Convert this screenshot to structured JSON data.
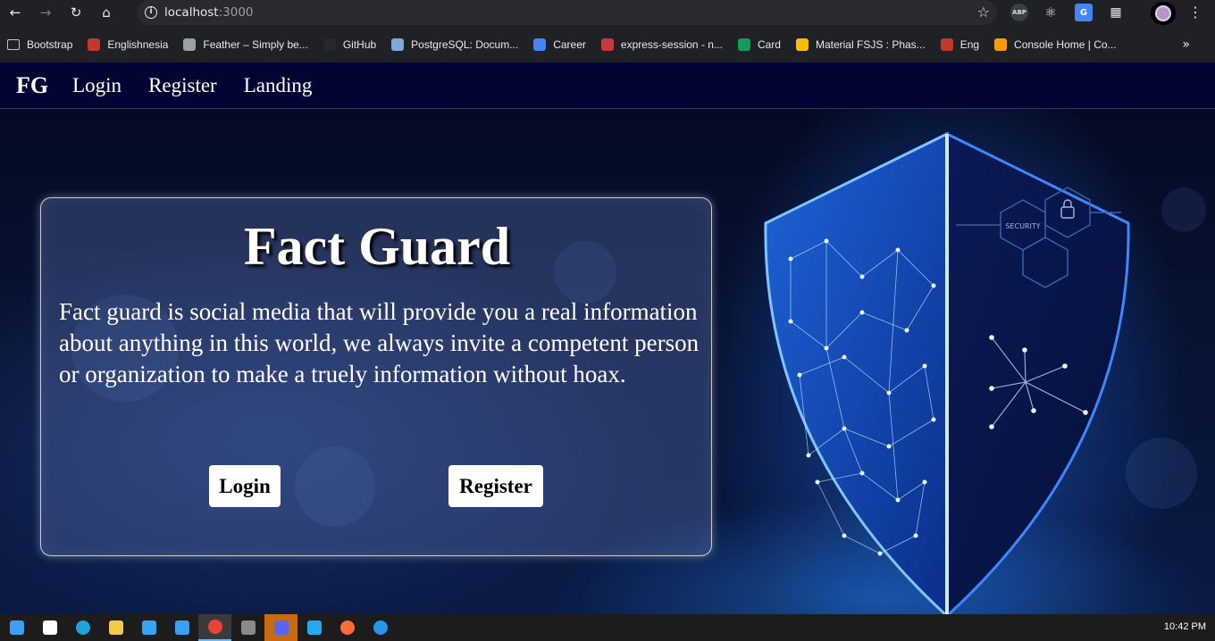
{
  "browser": {
    "url_host": "localhost",
    "url_port": ":3000",
    "extensions": {
      "abp_label": "ABP"
    }
  },
  "bookmarks": [
    {
      "label": "Bootstrap",
      "icon": "folder-icon",
      "color": "#c7c7c7"
    },
    {
      "label": "Englishnesia",
      "icon": "englishnesia-icon",
      "color": "#c0392b"
    },
    {
      "label": "Feather – Simply be...",
      "icon": "feather-icon",
      "color": "#9aa0a6"
    },
    {
      "label": "GitHub",
      "icon": "github-icon",
      "color": "#24292e"
    },
    {
      "label": "PostgreSQL: Docum...",
      "icon": "postgresql-icon",
      "color": "#7fa9d6"
    },
    {
      "label": "Career",
      "icon": "docs-icon",
      "color": "#4285f4"
    },
    {
      "label": "express-session - n...",
      "icon": "npm-icon",
      "color": "#cb3837"
    },
    {
      "label": "Card",
      "icon": "sheets-icon",
      "color": "#0f9d58"
    },
    {
      "label": "Material FSJS : Phas...",
      "icon": "drive-icon",
      "color": "#fbbc04"
    },
    {
      "label": "Eng",
      "icon": "eng-icon",
      "color": "#c0392b"
    },
    {
      "label": "Console Home | Co...",
      "icon": "aws-icon",
      "color": "#ff9900"
    }
  ],
  "app_nav": {
    "brand": "FG",
    "links": [
      "Login",
      "Register",
      "Landing"
    ]
  },
  "hero": {
    "title": "Fact Guard",
    "description": "Fact guard is social media that will provide you a real information about anything in this world, we always invite a competent person or organization to make a truely information without hoax.",
    "login_button": "Login",
    "register_button": "Register"
  },
  "shield": {
    "label": "SECURITY"
  },
  "taskbar": {
    "clock": "10:42 PM",
    "apps": [
      {
        "icon": "start-icon",
        "color": "#3aa0f3"
      },
      {
        "icon": "task-view-icon",
        "color": "#ffffff"
      },
      {
        "icon": "edge-icon",
        "color": "#1fa3d8"
      },
      {
        "icon": "file-explorer-icon",
        "color": "#f2c94c"
      },
      {
        "icon": "store-icon",
        "color": "#3aa0f3"
      },
      {
        "icon": "mail-icon",
        "color": "#3aa0f3"
      },
      {
        "icon": "chrome-icon",
        "color": "#ea4335"
      },
      {
        "icon": "calculator-icon",
        "color": "#8a8a8a"
      },
      {
        "icon": "discord-icon",
        "color": "#5865f2"
      },
      {
        "icon": "vscode-icon",
        "color": "#23a9f2"
      },
      {
        "icon": "postman-icon",
        "color": "#ff6c37"
      },
      {
        "icon": "docker-icon",
        "color": "#2496ed"
      }
    ]
  }
}
